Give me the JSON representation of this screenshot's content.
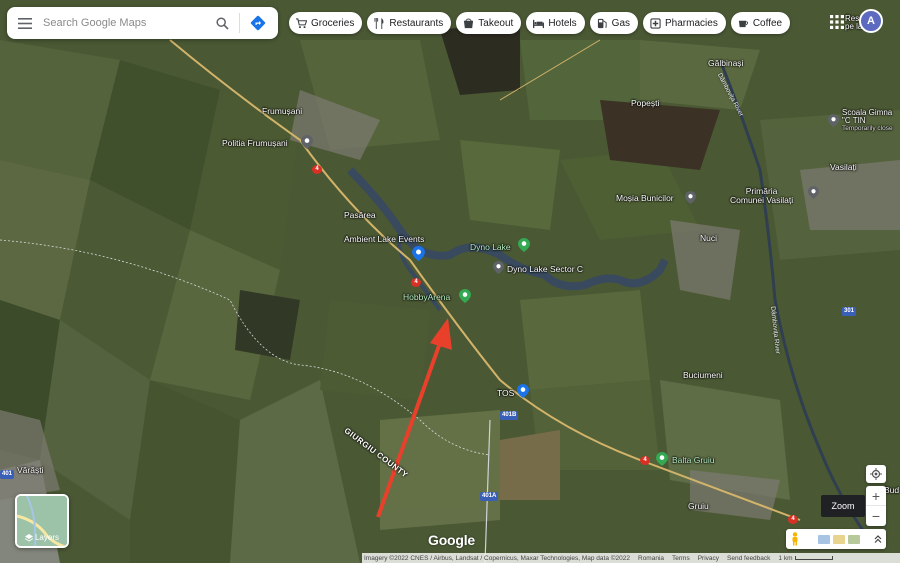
{
  "search": {
    "placeholder": "Search Google Maps"
  },
  "chips": [
    {
      "label": "Groceries",
      "icon": "cart-icon"
    },
    {
      "label": "Restaurants",
      "icon": "fork-knife-icon"
    },
    {
      "label": "Takeout",
      "icon": "takeout-icon"
    },
    {
      "label": "Hotels",
      "icon": "bed-icon"
    },
    {
      "label": "Gas",
      "icon": "gas-pump-icon"
    },
    {
      "label": "Pharmacies",
      "icon": "pharmacy-icon"
    },
    {
      "label": "Coffee",
      "icon": "coffee-icon"
    }
  ],
  "account": {
    "initial": "A"
  },
  "layers": {
    "label": "Layers"
  },
  "google_logo": "Google",
  "zoom_tooltip": "Zoom",
  "attribution": {
    "imagery": "Imagery ©2022 CNES / Airbus, Landsat / Copernicus, Maxar Technologies, Map data ©2022",
    "country": "Romania",
    "terms": "Terms",
    "privacy": "Privacy",
    "feedback": "Send feedback",
    "scale": "1 km"
  },
  "places": {
    "frumusani": "Frumușani",
    "politia": "Politia Frumușani",
    "pasarea": "Pasărea",
    "ambient": "Ambient Lake Events",
    "dyno_lake": "Dyno Lake",
    "dyno_sector": "Dyno Lake Sector C",
    "hobby_arena": "HobbyArena",
    "tos": "TOS",
    "balta_gruiu": "Balta Gruiu",
    "gruiu": "Gruiu",
    "buciumeni": "Buciumeni",
    "nuci": "Nuci",
    "mosia": "Moșia Bunicilor",
    "popesti": "Popești",
    "galbinasi": "Gălbinași",
    "primaria_1": "Primăria",
    "primaria_2": "Comunei Vasilați",
    "vasilati": "Vasilați",
    "scoala_1": "Scoala Gimna",
    "scoala_2": "\"C TIN",
    "scoala_3": "Temporarily close",
    "varasti": "Vărăști",
    "resort_1": "Resort ba",
    "resort_2": "pe la Soh",
    "bud": "Bud",
    "county": "GIURGIU COUNTY",
    "river_1": "Dâmbovița River",
    "river_2": "Dâmbovița River"
  },
  "roads": {
    "r4a": "4",
    "r4b": "4",
    "r4c": "4",
    "r4d": "4",
    "r401a": "401A",
    "r401b": "401B",
    "r301": "301",
    "r401": "401"
  },
  "colors": {
    "arrow": "#e8402a",
    "pin_green": "#34a853",
    "pin_gray": "#5f6368",
    "pin_blue": "#1a73e8"
  }
}
